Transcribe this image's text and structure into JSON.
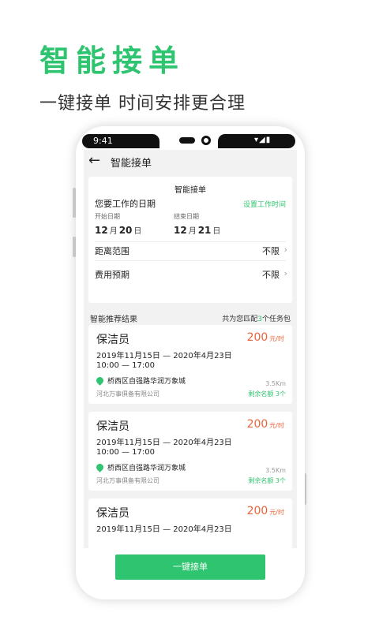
{
  "promo": {
    "title": "智能接单",
    "subtitle": "一键接单 时间安排更合理"
  },
  "status_bar": {
    "time": "9:41",
    "icons": "▾◢▮"
  },
  "header": {
    "back_icon": "arrow-left-icon",
    "title": "智能接单"
  },
  "form": {
    "title": "智能接单",
    "date_label": "您要工作的日期",
    "set_time_link": "设置工作时间",
    "start_label": "开始日期",
    "start_month": "12",
    "start_day": "20",
    "end_label": "结束日期",
    "end_month": "12",
    "end_day": "21",
    "month_unit": "月",
    "day_unit": "日",
    "distance_label": "距离范围",
    "distance_value": "不限",
    "budget_label": "费用预期",
    "budget_value": "不限"
  },
  "results": {
    "heading": "智能推荐结果",
    "match_prefix": "共为您匹配",
    "match_count": "3",
    "match_suffix": "个任务包"
  },
  "jobs": [
    {
      "title": "保洁员",
      "price": "200",
      "price_unit": "元/时",
      "dates": "2019年11月15日 — 2020年4月23日",
      "hours": "10:00 — 17:00",
      "address": "桥西区自强路华润万象城",
      "distance": "3.5Km",
      "company": "河北万事俱备有限公司",
      "remaining": "剩余名额 3个"
    },
    {
      "title": "保洁员",
      "price": "200",
      "price_unit": "元/时",
      "dates": "2019年11月15日 — 2020年4月23日",
      "hours": "10:00 — 17:00",
      "address": "桥西区自强路华润万象城",
      "distance": "3.5Km",
      "company": "河北万事俱备有限公司",
      "remaining": "剩余名额 3个"
    },
    {
      "title": "保洁员",
      "price": "200",
      "price_unit": "元/时",
      "dates": "2019年11月15日 — 2020年4月23日"
    }
  ],
  "footer": {
    "accept_button": "一键接单"
  },
  "colors": {
    "accent": "#2fc46f",
    "price": "#e9643a",
    "screen_bg": "#f2f2f2"
  }
}
